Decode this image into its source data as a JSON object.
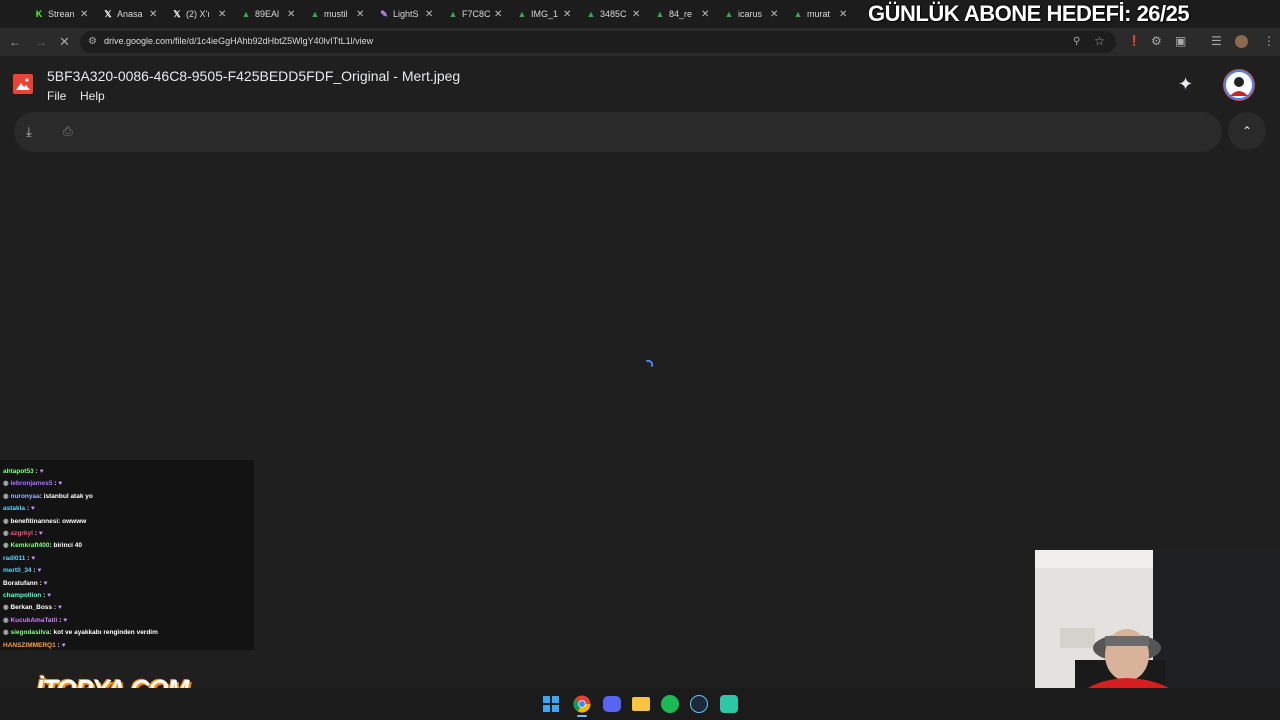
{
  "tabs": [
    {
      "label": "Strean",
      "icon": "kick-icon",
      "color": "#53fc18"
    },
    {
      "label": "Anasa",
      "icon": "x-icon",
      "color": "#ffffff"
    },
    {
      "label": "(2) X'ı",
      "icon": "x-icon",
      "color": "#ffffff"
    },
    {
      "label": "89EAl",
      "icon": "drive-icon",
      "color": "#34a853"
    },
    {
      "label": "mustil",
      "icon": "drive-icon",
      "color": "#34a853"
    },
    {
      "label": "LightS",
      "icon": "feather-icon",
      "color": "#b38cff"
    },
    {
      "label": "F7C8C",
      "icon": "drive-icon",
      "color": "#34a853"
    },
    {
      "label": "IMG_1",
      "icon": "drive-icon",
      "color": "#34a853"
    },
    {
      "label": "3485C",
      "icon": "drive-icon",
      "color": "#34a853"
    },
    {
      "label": "84_re",
      "icon": "drive-icon",
      "color": "#34a853"
    },
    {
      "label": "icarus",
      "icon": "drive-icon",
      "color": "#34a853"
    },
    {
      "label": "murat",
      "icon": "drive-icon",
      "color": "#34a853"
    }
  ],
  "overlay_banner": "GÜNLÜK ABONE HEDEFİ: 26/25",
  "address_bar": {
    "url": "drive.google.com/file/d/1c4ieGgHAhb92dHbtZ5WlgY40lvITtL1l/view"
  },
  "viewer": {
    "file_title": "5BF3A320-0086-46C8-9505-F425BEDD5FDF_Original - Mert.jpeg",
    "menu_file": "File",
    "menu_help": "Help"
  },
  "chat": [
    {
      "user": "ahtapot53",
      "msg": "",
      "heart": true,
      "color": "#7fff7f",
      "badge": false
    },
    {
      "user": "lebronjames5",
      "msg": "",
      "heart": true,
      "color": "#b070ff",
      "badge": true
    },
    {
      "user": "nuronyaa",
      "msg": ": istanbul atak yo",
      "heart": false,
      "color": "#9fb6ff",
      "badge": true
    },
    {
      "user": "astakla",
      "msg": "",
      "heart": true,
      "color": "#5fd3ff",
      "badge": false
    },
    {
      "user": "benefitinannesi",
      "msg": ": owwww",
      "heart": false,
      "color": "#ffffff",
      "badge": true
    },
    {
      "user": "azgrkyl",
      "msg": "",
      "heart": true,
      "color": "#ff4d7a",
      "badge": true
    },
    {
      "user": "Kemkraft400",
      "msg": ": birinci 40",
      "heart": false,
      "color": "#7fff7f",
      "badge": true
    },
    {
      "user": "radi011",
      "msg": "",
      "heart": true,
      "color": "#5fd3ff",
      "badge": false
    },
    {
      "user": "mert0_34",
      "msg": "",
      "heart": true,
      "color": "#5fd3ff",
      "badge": false
    },
    {
      "user": "Boratufann",
      "msg": "",
      "heart": true,
      "color": "#ffffff",
      "badge": false
    },
    {
      "user": "champollion",
      "msg": "",
      "heart": true,
      "color": "#5fffcf",
      "badge": false
    },
    {
      "user": "Berkan_Boss",
      "msg": "",
      "heart": true,
      "color": "#ffffff",
      "badge": true
    },
    {
      "user": "KucukAmaTatli",
      "msg": "",
      "heart": true,
      "color": "#d07fff",
      "badge": true
    },
    {
      "user": "siegodasilva",
      "msg": ": kot ve ayakkabı renginden verdim",
      "heart": false,
      "color": "#7fff7f",
      "badge": true
    },
    {
      "user": "HANSZIMMERQ1",
      "msg": "",
      "heart": true,
      "color": "#ff9f3f",
      "badge": false
    }
  ],
  "sponsor_logo": "İTOPYA.COM",
  "taskbar": {
    "apps": [
      "windows-start-icon",
      "chrome-icon",
      "discord-icon",
      "file-explorer-icon",
      "spotify-icon",
      "steam-icon",
      "app-icon"
    ]
  }
}
